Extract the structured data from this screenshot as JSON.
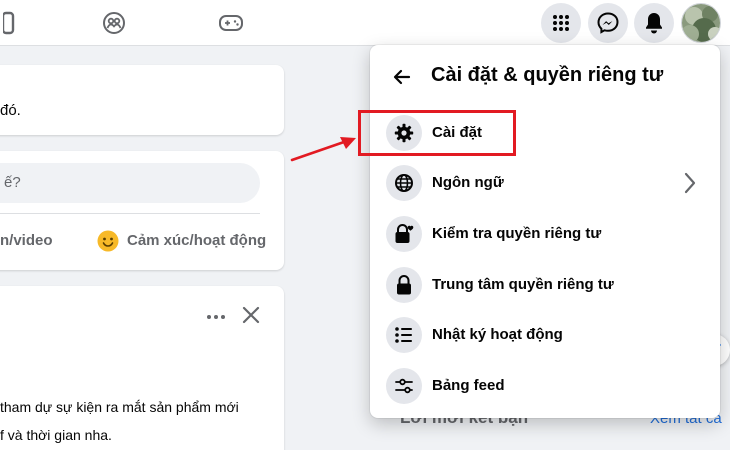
{
  "panel": {
    "title": "Cài đặt & quyền riêng tư",
    "items": [
      {
        "label": "Cài đặt",
        "icon": "gear-icon"
      },
      {
        "label": "Ngôn ngữ",
        "icon": "globe-icon",
        "has_submenu": true
      },
      {
        "label": "Kiểm tra quyền riêng tư",
        "icon": "lock-heart-icon"
      },
      {
        "label": "Trung tâm quyền riêng tư",
        "icon": "lock-icon"
      },
      {
        "label": "Nhật ký hoạt động",
        "icon": "list-icon"
      },
      {
        "label": "Bảng feed",
        "icon": "sliders-icon"
      }
    ]
  },
  "feed": {
    "card1_text": "đó.",
    "composer_placeholder": "ế?",
    "action_photo": "n/video",
    "action_feeling": "Cảm xúc/hoạt động",
    "post_line1": "tham dự sự kiện ra mắt sản phẩm mới",
    "post_line2": "f và thời gian nha."
  },
  "sidebar_right": {
    "friend_requests": "Lời mời kết bạn",
    "see_all": "Xem tất cả"
  },
  "colors": {
    "accent": "#1877f2",
    "highlight": "#e21a22",
    "link": "#216fdb"
  }
}
